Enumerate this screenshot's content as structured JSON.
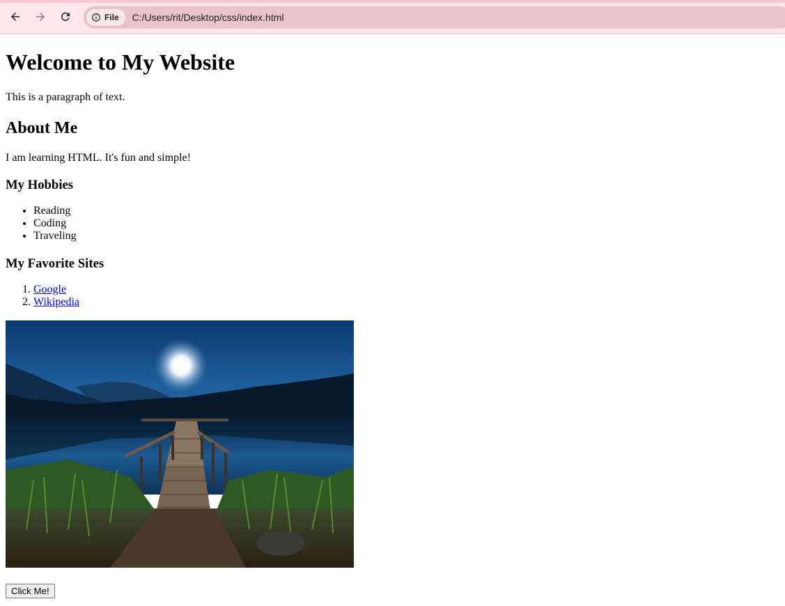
{
  "browser": {
    "chip_label": "File",
    "url": "C:/Users/rit/Desktop/css/index.html"
  },
  "page": {
    "title": "Welcome to My Website",
    "intro": "This is a paragraph of text.",
    "about_heading": "About Me",
    "about_text": "I am learning HTML. It's fun and simple!",
    "hobbies_heading": "My Hobbies",
    "hobbies": [
      "Reading",
      "Coding",
      "Traveling"
    ],
    "sites_heading": "My Favorite Sites",
    "sites": [
      {
        "label": "Google"
      },
      {
        "label": "Wikipedia"
      }
    ],
    "button_label": "Click Me!"
  }
}
